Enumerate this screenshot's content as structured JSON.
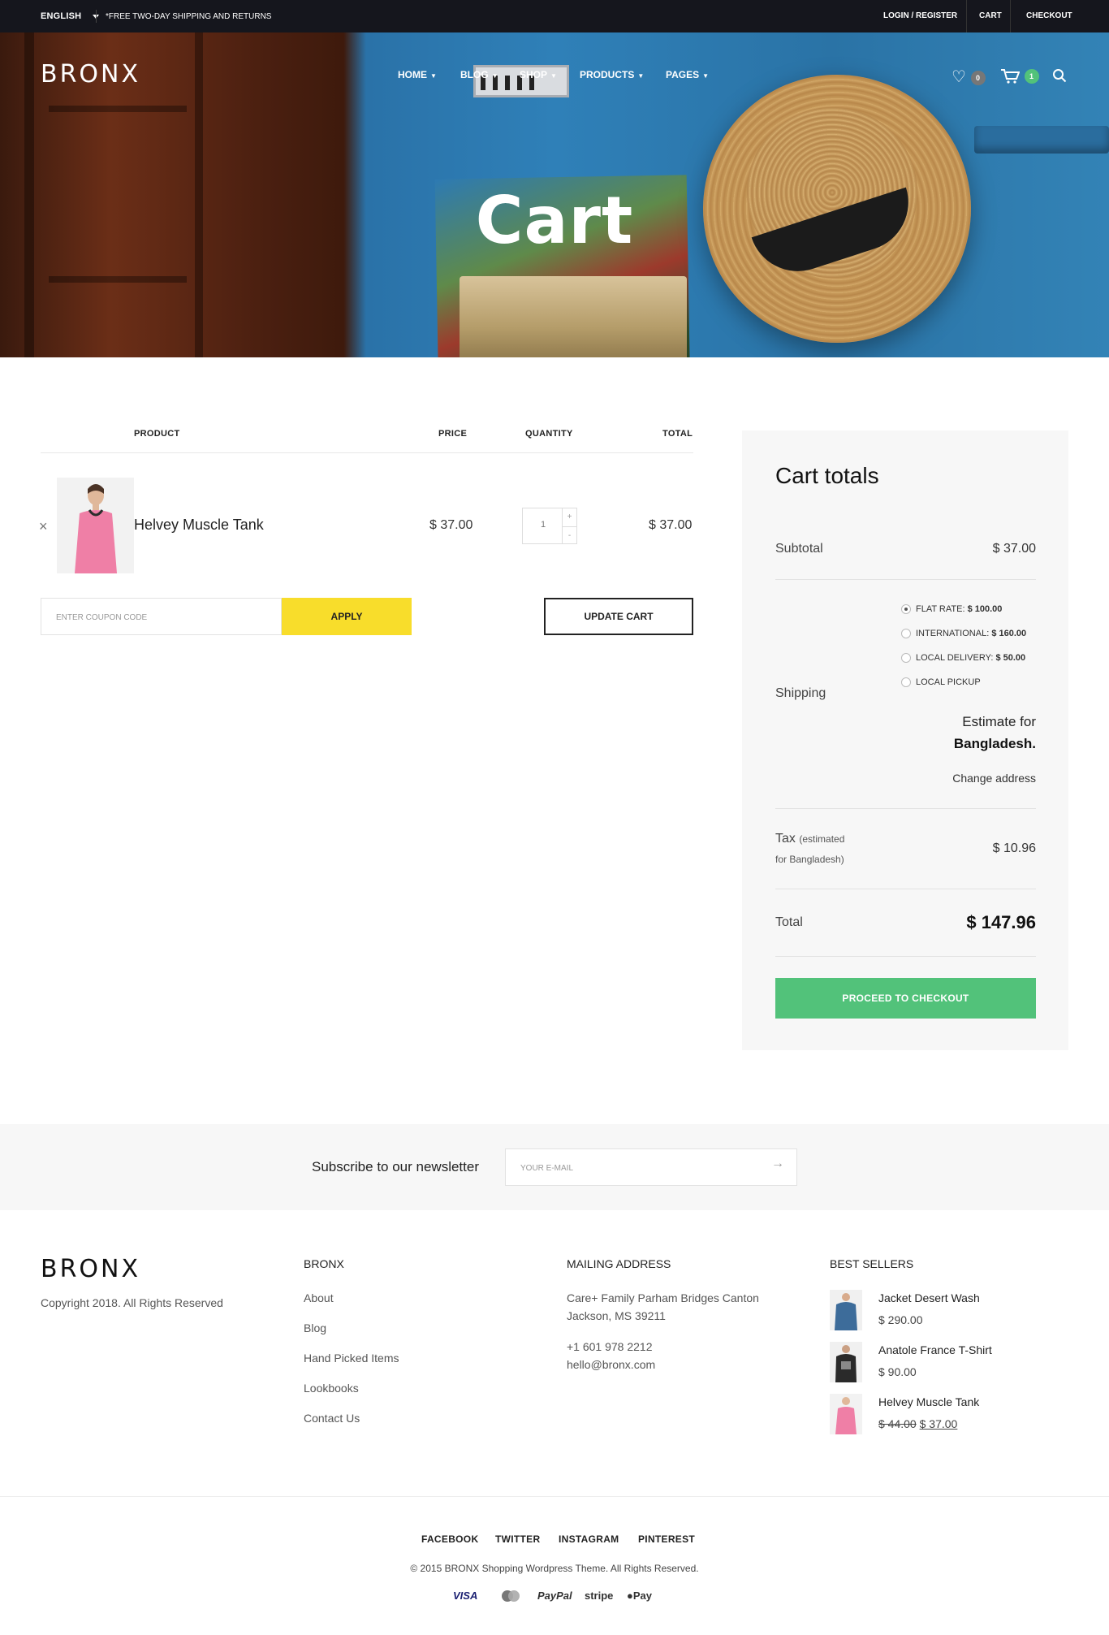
{
  "topbar": {
    "language": "ENGLISH",
    "promo": "*FREE TWO-DAY SHIPPING AND RETURNS",
    "login": "LOGIN / REGISTER",
    "cart": "CART",
    "checkout": "CHECKOUT"
  },
  "header": {
    "logo": "BRONX",
    "nav": [
      "HOME",
      "BLOG",
      "SHOP",
      "PRODUCTS",
      "PAGES"
    ],
    "wishlist_count": "0",
    "cart_count": "1",
    "title": "Cart"
  },
  "cart": {
    "columns": {
      "product": "PRODUCT",
      "price": "PRICE",
      "quantity": "QUANTITY",
      "total": "TOTAL"
    },
    "items": [
      {
        "name": "Helvey Muscle Tank",
        "price": "$ 37.00",
        "quantity": "1",
        "total": "$ 37.00"
      }
    ],
    "coupon_placeholder": "ENTER COUPON CODE",
    "apply_label": "APPLY",
    "update_label": "UPDATE CART"
  },
  "totals": {
    "title": "Cart totals",
    "subtotal_label": "Subtotal",
    "subtotal_value": "$ 37.00",
    "shipping_label": "Shipping",
    "shipping_options": [
      {
        "label": "FLAT RATE:",
        "price": "$ 100.00",
        "selected": true
      },
      {
        "label": "INTERNATIONAL:",
        "price": "$ 160.00",
        "selected": false
      },
      {
        "label": "LOCAL DELIVERY:",
        "price": "$ 50.00",
        "selected": false
      },
      {
        "label": "LOCAL PICKUP",
        "price": "",
        "selected": false
      }
    ],
    "estimate_prefix": "Estimate for",
    "estimate_country": "Bangladesh.",
    "change_address": "Change address",
    "tax_label": "Tax",
    "tax_note_1": "(estimated",
    "tax_note_2": "for Bangladesh)",
    "tax_value": "$ 10.96",
    "total_label": "Total",
    "total_value": "$ 147.96",
    "checkout_label": "PROCEED TO CHECKOUT"
  },
  "newsletter": {
    "label": "Subscribe to our newsletter",
    "placeholder": "YOUR E-MAIL"
  },
  "footer": {
    "logo": "BRONX",
    "copyright": "Copyright 2018. All Rights Reserved",
    "bronx_heading": "BRONX",
    "bronx_links": [
      "About",
      "Blog",
      "Hand Picked Items",
      "Lookbooks",
      "Contact Us"
    ],
    "mailing_heading": "MAILING ADDRESS",
    "address_line1": "Care+ Family Parham Bridges Canton",
    "address_line2": "Jackson, MS 39211",
    "phone": "+1 601 978 2212",
    "email": "hello@bronx.com",
    "bestsellers_heading": "BEST SELLERS",
    "bestsellers": [
      {
        "name": "Jacket Desert Wash",
        "price": "$ 290.00",
        "old_price": ""
      },
      {
        "name": "Anatole France T-Shirt",
        "price": "$ 90.00",
        "old_price": ""
      },
      {
        "name": "Helvey Muscle Tank",
        "price": "$ 37.00",
        "old_price": "$ 44.00"
      }
    ],
    "social": [
      "FACEBOOK",
      "TWITTER",
      "INSTAGRAM",
      "PINTEREST"
    ],
    "credit": "© 2015 BRONX Shopping Wordpress Theme. All Rights Reserved.",
    "payments": [
      "VISA",
      "PayPal",
      "stripe",
      "Pay"
    ]
  },
  "colors": {
    "topbar": "#15161d",
    "apply": "#f8dd2b",
    "checkout": "#52c27a",
    "badge_wishlist": "#777777",
    "badge_cart": "#52c27a"
  }
}
